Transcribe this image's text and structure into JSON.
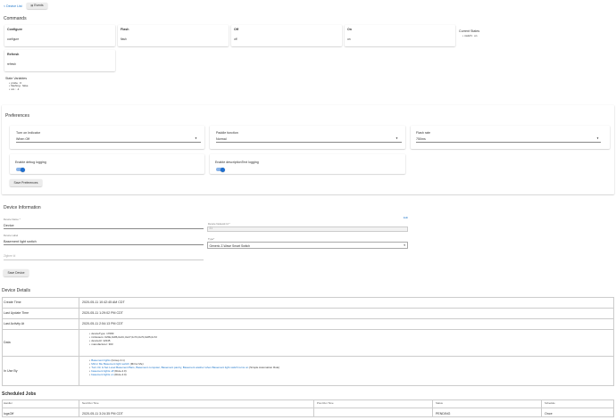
{
  "topnav": {
    "back_link": "< Device List",
    "events_button": "Events"
  },
  "commands": {
    "title": "Commands",
    "items": [
      {
        "label": "Configure",
        "sub": "configure"
      },
      {
        "label": "Flash",
        "sub": "flash"
      },
      {
        "label": "Off",
        "sub": "off"
      },
      {
        "label": "On",
        "sub": "on"
      },
      {
        "label": "Refresh",
        "sub": "refresh"
      }
    ],
    "current_states_title": "Current States",
    "current_states": [
      "switch : on"
    ]
  },
  "state_variables": {
    "title": "State Variables",
    "items": [
      "probe : 0",
      "flashing : false",
      "sm : -1"
    ]
  },
  "preferences": {
    "title": "Preferences",
    "fields": [
      {
        "label": "Turn on Indicator",
        "value": "When Off"
      },
      {
        "label": "Paddle function",
        "value": "Normal"
      },
      {
        "label": "Flash rate",
        "value": "750ms"
      }
    ],
    "toggles": [
      {
        "label": "Enable debug logging",
        "on": true
      },
      {
        "label": "Enable descriptionText logging",
        "on": true
      }
    ],
    "save_button": "Save Preferences"
  },
  "device_info": {
    "title": "Device Information",
    "name_label": "Device Name *",
    "name_value": "Device",
    "network_id_label": "Device Network Id *",
    "network_id_value": "21",
    "label_label": "Device Label",
    "label_value": "Basement light switch",
    "type_label": "Type*",
    "type_value": "Generic Z-Wave Smart Switch",
    "zigbee_id_placeholder": "Zigbee Id",
    "edit_link": "Edit",
    "save_button": "Save Device"
  },
  "device_details": {
    "title": "Device Details",
    "rows": [
      {
        "label": "Create Time",
        "value": "2020-05-11 10:42:45 AM CDT"
      },
      {
        "label": "Last Update Time",
        "value": "2020-05-11 1:29:02 PM CDT"
      },
      {
        "label": "Last Activity At",
        "value": "2020-05-11 2:54:13 PM CDT"
      }
    ],
    "data_label": "Data",
    "data_items": [
      "deviceType: 17683",
      "inClusters: 0x5E,0x86,0x2C,0x27,0x73,0x70,0x85,0x72",
      "deviceId: 12345",
      "manufacturer: 303"
    ],
    "in_use_label": "In Use By",
    "in_use_items": [
      {
        "link": "Basement lights",
        "note": " (Group 4.1)"
      },
      {
        "link": "Mirror Me Basement light switch",
        "note": " (Mirror Me)"
      },
      {
        "link": "Turn On & Set Level Basement Bars, Basement computer, Basement pantry, Basement washer when Basement light switch turns on",
        "note": " (Simple Automation Rule)"
      },
      {
        "link": "basement lights off",
        "note": " (Rule-4.0)"
      },
      {
        "link": "basement lights on",
        "note": " (Rule-4.0)"
      }
    ]
  },
  "scheduled_jobs": {
    "title": "Scheduled Jobs",
    "headers": [
      "Handler",
      "Next Run Time",
      "Prev Run Time",
      "Status",
      "Schedule"
    ],
    "rows": [
      {
        "handler": "logsOff",
        "next": "2020-05-11 3:24:35 PM CDT",
        "prev": "",
        "status": "PENDING",
        "schedule": "Once"
      }
    ]
  }
}
